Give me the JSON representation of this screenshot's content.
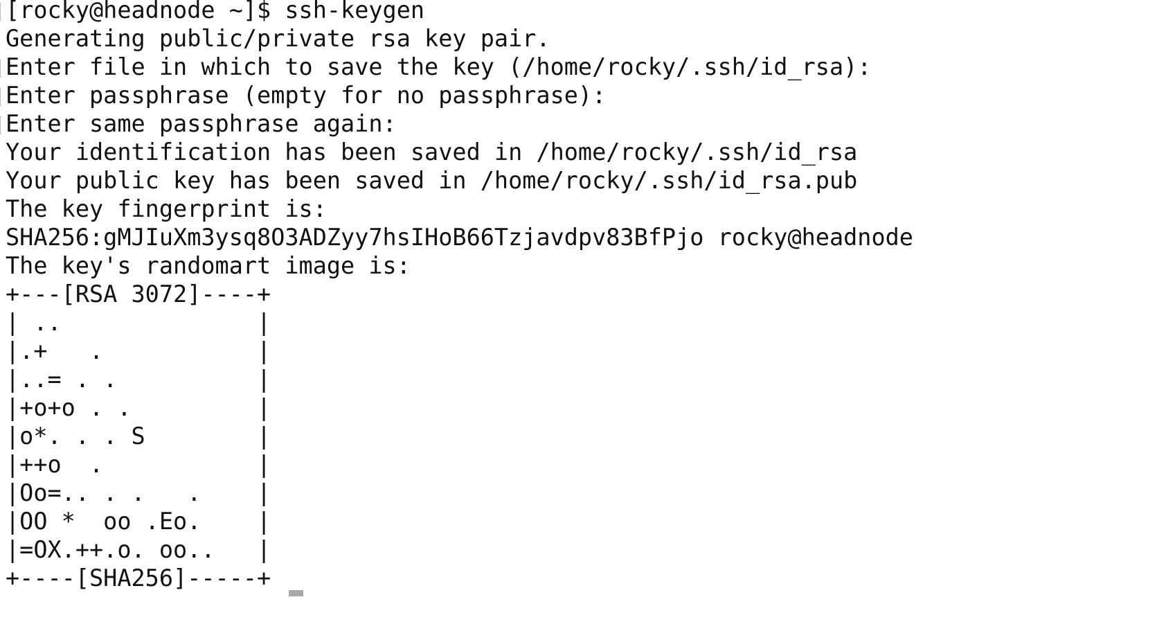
{
  "terminal": {
    "lines": [
      "[rocky@headnode ~]$ ssh-keygen",
      "Generating public/private rsa key pair.",
      "Enter file in which to save the key (/home/rocky/.ssh/id_rsa):",
      "Enter passphrase (empty for no passphrase):",
      "Enter same passphrase again:",
      "Your identification has been saved in /home/rocky/.ssh/id_rsa",
      "Your public key has been saved in /home/rocky/.ssh/id_rsa.pub",
      "The key fingerprint is:",
      "SHA256:gMJIuXm3ysq8O3ADZyy7hsIHoB66Tzjavdpv83BfPjo rocky@headnode",
      "The key's randomart image is:",
      "+---[RSA 3072]----+",
      "| ..              |",
      "|.+   .           |",
      "|..= . .          |",
      "|+o+o . .         |",
      "|o*. . . S        |",
      "|++o  .           |",
      "|Oo=.. . .   .    |",
      "|OO *  oo .Eo.    |",
      "|=OX.++.o. oo..   |",
      "+----[SHA256]-----+"
    ]
  }
}
